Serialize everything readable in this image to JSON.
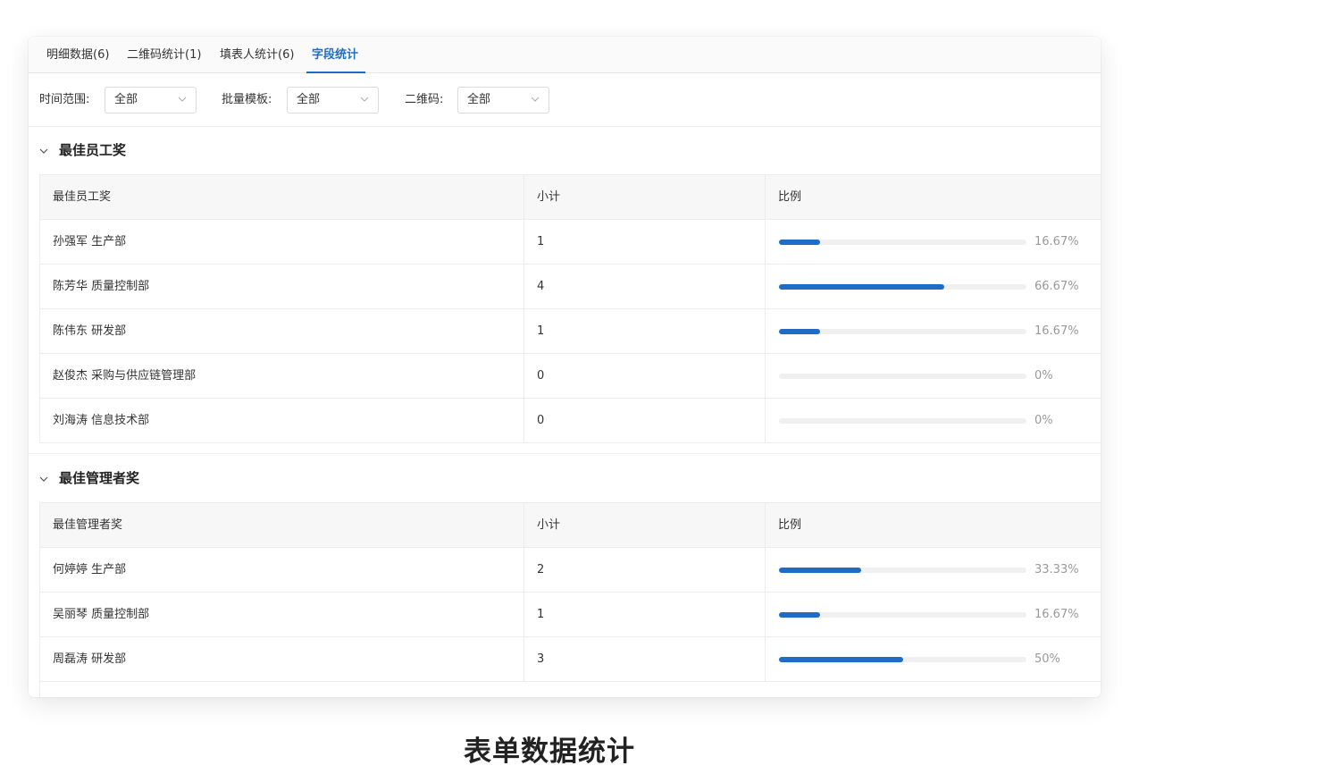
{
  "tabs": [
    {
      "label": "明细数据(6)",
      "active": false
    },
    {
      "label": "二维码统计(1)",
      "active": false
    },
    {
      "label": "填表人统计(6)",
      "active": false
    },
    {
      "label": "字段统计",
      "active": true
    }
  ],
  "filters": {
    "time_label": "时间范围:",
    "time_value": "全部",
    "template_label": "批量模板:",
    "template_value": "全部",
    "qrcode_label": "二维码:",
    "qrcode_value": "全部"
  },
  "sections": [
    {
      "title": "最佳员工奖",
      "columns": [
        "最佳员工奖",
        "小计",
        "比例"
      ],
      "rows": [
        {
          "name": "孙强军 生产部",
          "count": "1",
          "ratio": 16.67,
          "pct": "16.67%"
        },
        {
          "name": "陈芳华 质量控制部",
          "count": "4",
          "ratio": 66.67,
          "pct": "66.67%"
        },
        {
          "name": "陈伟东 研发部",
          "count": "1",
          "ratio": 16.67,
          "pct": "16.67%"
        },
        {
          "name": "赵俊杰 采购与供应链管理部",
          "count": "0",
          "ratio": 0,
          "pct": "0%"
        },
        {
          "name": "刘海涛 信息技术部",
          "count": "0",
          "ratio": 0,
          "pct": "0%"
        }
      ]
    },
    {
      "title": "最佳管理者奖",
      "columns": [
        "最佳管理者奖",
        "小计",
        "比例"
      ],
      "rows": [
        {
          "name": "何婷婷 生产部",
          "count": "2",
          "ratio": 33.33,
          "pct": "33.33%"
        },
        {
          "name": "吴丽琴 质量控制部",
          "count": "1",
          "ratio": 16.67,
          "pct": "16.67%"
        },
        {
          "name": "周磊涛 研发部",
          "count": "3",
          "ratio": 50,
          "pct": "50%"
        }
      ]
    }
  ],
  "caption": "表单数据统计",
  "colors": {
    "accent": "#1f6cc7",
    "track": "#f0f0f0"
  }
}
